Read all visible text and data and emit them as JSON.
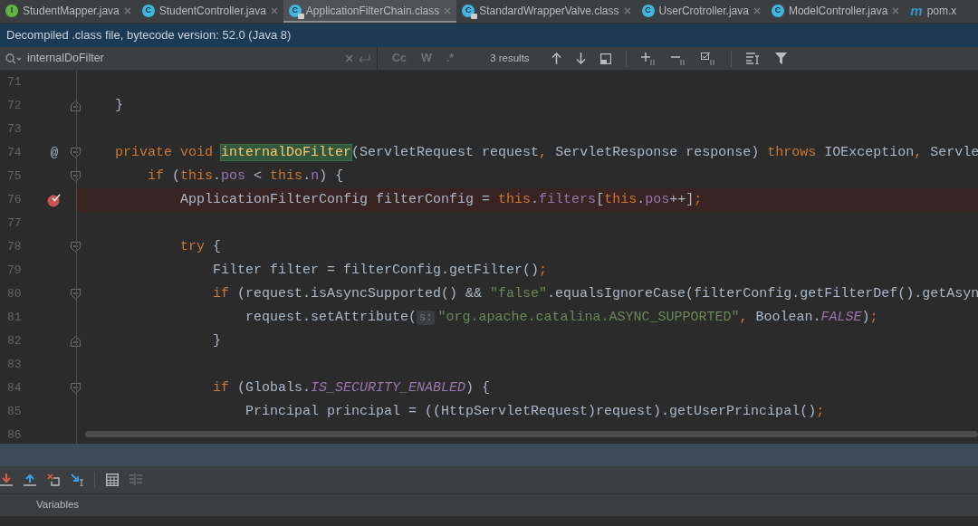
{
  "tabs": [
    {
      "label": "StudentMapper.java",
      "icon": "I",
      "kind": "interface",
      "locked": false,
      "selected": false
    },
    {
      "label": "StudentController.java",
      "icon": "C",
      "kind": "class",
      "locked": false,
      "selected": false
    },
    {
      "label": "ApplicationFilterChain.class",
      "icon": "C",
      "kind": "class",
      "locked": true,
      "selected": true
    },
    {
      "label": "StandardWrapperValve.class",
      "icon": "C",
      "kind": "class",
      "locked": true,
      "selected": false
    },
    {
      "label": "UserCrotroller.java",
      "icon": "C",
      "kind": "class",
      "locked": false,
      "selected": false
    },
    {
      "label": "ModelController.java",
      "icon": "C",
      "kind": "class",
      "locked": false,
      "selected": false
    },
    {
      "label": "pom.x",
      "icon": "m",
      "kind": "maven",
      "locked": false,
      "selected": false
    }
  ],
  "banner": "Decompiled .class file, bytecode version: 52.0 (Java 8)",
  "find": {
    "query": "internalDoFilter",
    "toggles": [
      "Cc",
      "W",
      ".*"
    ],
    "results": "3 results"
  },
  "lines": [
    {
      "number": "71",
      "fold_open": false,
      "fold_close": false,
      "breakpoint": false
    },
    {
      "number": "72",
      "fold_open": false,
      "fold_close": true,
      "breakpoint": false,
      "tokens": [
        {
          "text": "    }",
          "kind": "plain"
        }
      ]
    },
    {
      "number": "73",
      "fold_open": false,
      "fold_close": false,
      "breakpoint": false
    },
    {
      "number": "74",
      "marker": "@",
      "fold_open": true,
      "fold_close": false,
      "breakpoint": false,
      "tokens": [
        {
          "text": "    private void ",
          "kind": "keyword"
        },
        {
          "text": "internalDoFilter",
          "kind": "method",
          "match": true
        },
        {
          "text": "(ServletRequest request",
          "kind": "plain"
        },
        {
          "text": ", ",
          "kind": "keyword"
        },
        {
          "text": "ServletResponse response) ",
          "kind": "plain"
        },
        {
          "text": "throws ",
          "kind": "keyword"
        },
        {
          "text": "IOException",
          "kind": "plain"
        },
        {
          "text": ", ",
          "kind": "keyword"
        },
        {
          "text": "Servle",
          "kind": "plain"
        }
      ]
    },
    {
      "number": "75",
      "fold_open": true,
      "fold_close": false,
      "breakpoint": false,
      "tokens": [
        {
          "text": "        if ",
          "kind": "keyword"
        },
        {
          "text": "(",
          "kind": "plain"
        },
        {
          "text": "this",
          "kind": "keyword"
        },
        {
          "text": ".",
          "kind": "plain"
        },
        {
          "text": "pos",
          "kind": "field"
        },
        {
          "text": " < ",
          "kind": "plain"
        },
        {
          "text": "this",
          "kind": "keyword"
        },
        {
          "text": ".",
          "kind": "plain"
        },
        {
          "text": "n",
          "kind": "field"
        },
        {
          "text": ") {",
          "kind": "plain"
        }
      ]
    },
    {
      "number": "76",
      "fold_open": false,
      "fold_close": false,
      "breakpoint": true,
      "tokens": [
        {
          "text": "            ApplicationFilterConfig filterConfig = ",
          "kind": "plain"
        },
        {
          "text": "this",
          "kind": "keyword"
        },
        {
          "text": ".",
          "kind": "plain"
        },
        {
          "text": "filters",
          "kind": "field"
        },
        {
          "text": "[",
          "kind": "plain"
        },
        {
          "text": "this",
          "kind": "keyword"
        },
        {
          "text": ".",
          "kind": "plain"
        },
        {
          "text": "pos",
          "kind": "field"
        },
        {
          "text": "++]",
          "kind": "plain"
        },
        {
          "text": ";",
          "kind": "keyword"
        }
      ]
    },
    {
      "number": "77",
      "fold_open": false,
      "fold_close": false,
      "breakpoint": false
    },
    {
      "number": "78",
      "fold_open": true,
      "fold_close": false,
      "breakpoint": false,
      "tokens": [
        {
          "text": "            try ",
          "kind": "keyword"
        },
        {
          "text": "{",
          "kind": "plain"
        }
      ]
    },
    {
      "number": "79",
      "fold_open": false,
      "fold_close": false,
      "breakpoint": false,
      "tokens": [
        {
          "text": "                Filter filter = filterConfig.getFilter()",
          "kind": "plain"
        },
        {
          "text": ";",
          "kind": "keyword"
        }
      ]
    },
    {
      "number": "80",
      "fold_open": true,
      "fold_close": false,
      "breakpoint": false,
      "tokens": [
        {
          "text": "                if ",
          "kind": "keyword"
        },
        {
          "text": "(request.isAsyncSupported() && ",
          "kind": "plain"
        },
        {
          "text": "\"false\"",
          "kind": "string"
        },
        {
          "text": ".equalsIgnoreCase(filterConfig.getFilterDef().getAsyn",
          "kind": "plain"
        }
      ]
    },
    {
      "number": "81",
      "fold_open": false,
      "fold_close": false,
      "breakpoint": false,
      "tokens": [
        {
          "text": "                    request.setAttribute(",
          "kind": "plain"
        },
        {
          "text": "s:",
          "kind": "hint"
        },
        {
          "text": "\"org.apache.catalina.ASYNC_SUPPORTED\"",
          "kind": "string"
        },
        {
          "text": ", ",
          "kind": "keyword"
        },
        {
          "text": "Boolean.",
          "kind": "plain"
        },
        {
          "text": "FALSE",
          "kind": "constant"
        },
        {
          "text": ")",
          "kind": "plain"
        },
        {
          "text": ";",
          "kind": "keyword"
        }
      ]
    },
    {
      "number": "82",
      "fold_open": false,
      "fold_close": true,
      "breakpoint": false,
      "tokens": [
        {
          "text": "                }",
          "kind": "plain"
        }
      ]
    },
    {
      "number": "83",
      "fold_open": false,
      "fold_close": false,
      "breakpoint": false
    },
    {
      "number": "84",
      "fold_open": true,
      "fold_close": false,
      "breakpoint": false,
      "tokens": [
        {
          "text": "                if ",
          "kind": "keyword"
        },
        {
          "text": "(Globals.",
          "kind": "plain"
        },
        {
          "text": "IS_SECURITY_ENABLED",
          "kind": "constant"
        },
        {
          "text": ") {",
          "kind": "plain"
        }
      ]
    },
    {
      "number": "85",
      "fold_open": false,
      "fold_close": false,
      "breakpoint": false,
      "tokens": [
        {
          "text": "                    Principal principal = ((HttpServletRequest)request).getUserPrincipal()",
          "kind": "plain"
        },
        {
          "text": ";",
          "kind": "keyword"
        }
      ]
    },
    {
      "number": "86",
      "fold_open": false,
      "fold_close": false,
      "breakpoint": false
    }
  ],
  "debug": {
    "tools": [
      {
        "kind": "step-down",
        "disabled": false
      },
      {
        "kind": "step-up",
        "disabled": false
      },
      {
        "kind": "drop-frame",
        "disabled": false
      },
      {
        "kind": "cursor",
        "disabled": false
      },
      {
        "kind": "calculator",
        "disabled": false
      },
      {
        "kind": "stream",
        "disabled": true
      }
    ],
    "variables_label": "Variables"
  }
}
